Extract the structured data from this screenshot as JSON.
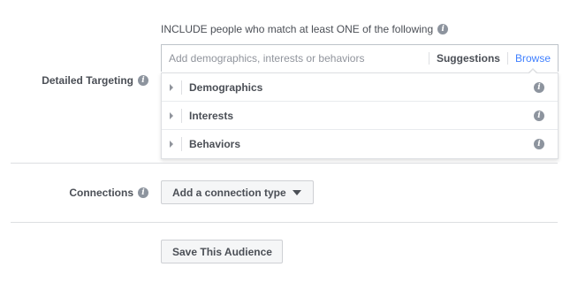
{
  "include": {
    "text": "INCLUDE people who match at least ONE of the following"
  },
  "detailed_targeting": {
    "label": "Detailed Targeting"
  },
  "search": {
    "placeholder": "Add demographics, interests or behaviors",
    "value": ""
  },
  "tabs": {
    "suggestions": "Suggestions",
    "browse": "Browse",
    "active": "Browse"
  },
  "categories": [
    {
      "label": "Demographics"
    },
    {
      "label": "Interests"
    },
    {
      "label": "Behaviors"
    }
  ],
  "connections": {
    "label": "Connections",
    "button_label": "Add a connection type"
  },
  "save": {
    "button_label": "Save This Audience"
  },
  "icons": {
    "info": "info-icon",
    "caret_right": "caret-right-icon",
    "caret_down": "caret-down-icon"
  },
  "colors": {
    "accent": "#4080ff",
    "text": "#4b4f56",
    "icon_gray": "#8d949e",
    "border": "#dddfe2"
  }
}
